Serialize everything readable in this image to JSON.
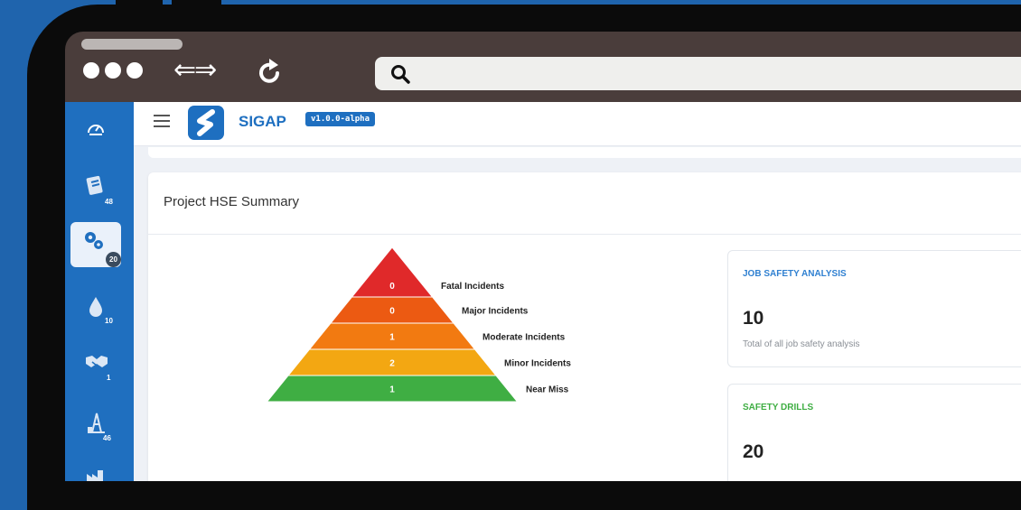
{
  "app": {
    "name": "SIGAP",
    "version": "v1.0.0-alpha"
  },
  "sidebar": {
    "items": [
      {
        "icon": "speedometer-icon",
        "badge": ""
      },
      {
        "icon": "clipboard-list-icon",
        "badge": "48"
      },
      {
        "icon": "gears-icon",
        "badge": "20",
        "active": true
      },
      {
        "icon": "water-drop-icon",
        "badge": "10"
      },
      {
        "icon": "handshake-icon",
        "badge": "1"
      },
      {
        "icon": "oil-rig-icon",
        "badge": "46"
      },
      {
        "icon": "factory-icon",
        "badge": ""
      }
    ]
  },
  "card": {
    "title": "Project HSE Summary"
  },
  "pyramid": {
    "levels": [
      {
        "label": "Fatal Incidents",
        "value": "0",
        "color": "#e0292a"
      },
      {
        "label": "Major Incidents",
        "value": "0",
        "color": "#ec5a12"
      },
      {
        "label": "Moderate Incidents",
        "value": "1",
        "color": "#f27a11"
      },
      {
        "label": "Minor Incidents",
        "value": "2",
        "color": "#f3a712"
      },
      {
        "label": "Near Miss",
        "value": "1",
        "color": "#3fae43"
      }
    ]
  },
  "stats": [
    {
      "label": "JOB SAFETY ANALYSIS",
      "value": "10",
      "description": "Total of all job safety analysis",
      "color": "#2f80d1"
    },
    {
      "label": "SAFETY DRILLS",
      "value": "20",
      "description": "",
      "color": "#3fae43"
    }
  ]
}
